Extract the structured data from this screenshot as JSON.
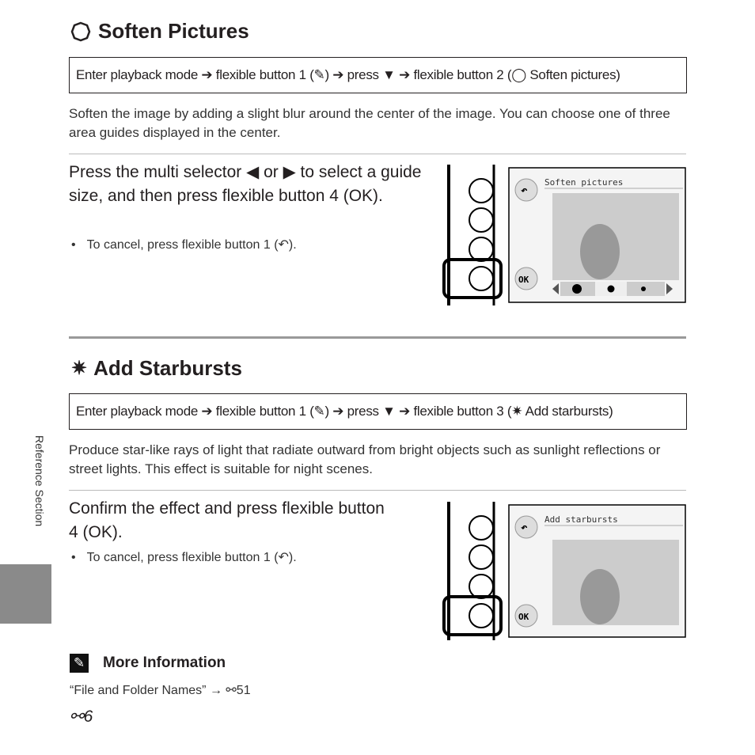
{
  "soften": {
    "title": "Soften Pictures",
    "icon": "soften-icon",
    "nav": "Enter playback mode ➔ flexible button 1 (✎) ➔ press ▼ ➔ flexible button 2 (◯ Soften pictures)",
    "description": "Soften the image by adding a slight blur around the center of the image. You can choose one of three area guides displayed in the center.",
    "step": "Press the multi selector ◀ or ▶ to select a guide size, and then press flexible button 4 (OK).",
    "bullet": "To cancel, press flexible button 1 (↶).",
    "screen": {
      "title": "Soften pictures",
      "ok_label": "OK"
    }
  },
  "starbursts": {
    "title": "Add Starbursts",
    "icon": "starburst-icon",
    "nav": "Enter playback mode ➔ flexible button 1 (✎) ➔ press ▼ ➔ flexible button 3 (✷ Add starbursts)",
    "description": "Produce star-like rays of light that radiate outward from bright objects such as sunlight reflections or street lights. This effect is suitable for night scenes.",
    "step": "Confirm the effect and press flexible button 4 (OK).",
    "bullet": "To cancel, press flexible button 1 (↶).",
    "screen": {
      "title": "Add starbursts",
      "ok_label": "OK"
    }
  },
  "more_info": {
    "title": "More Information",
    "reference": "“File and Folder Names” → ⚯51"
  },
  "side_tab": "Reference Section",
  "page_number": "⚯6"
}
